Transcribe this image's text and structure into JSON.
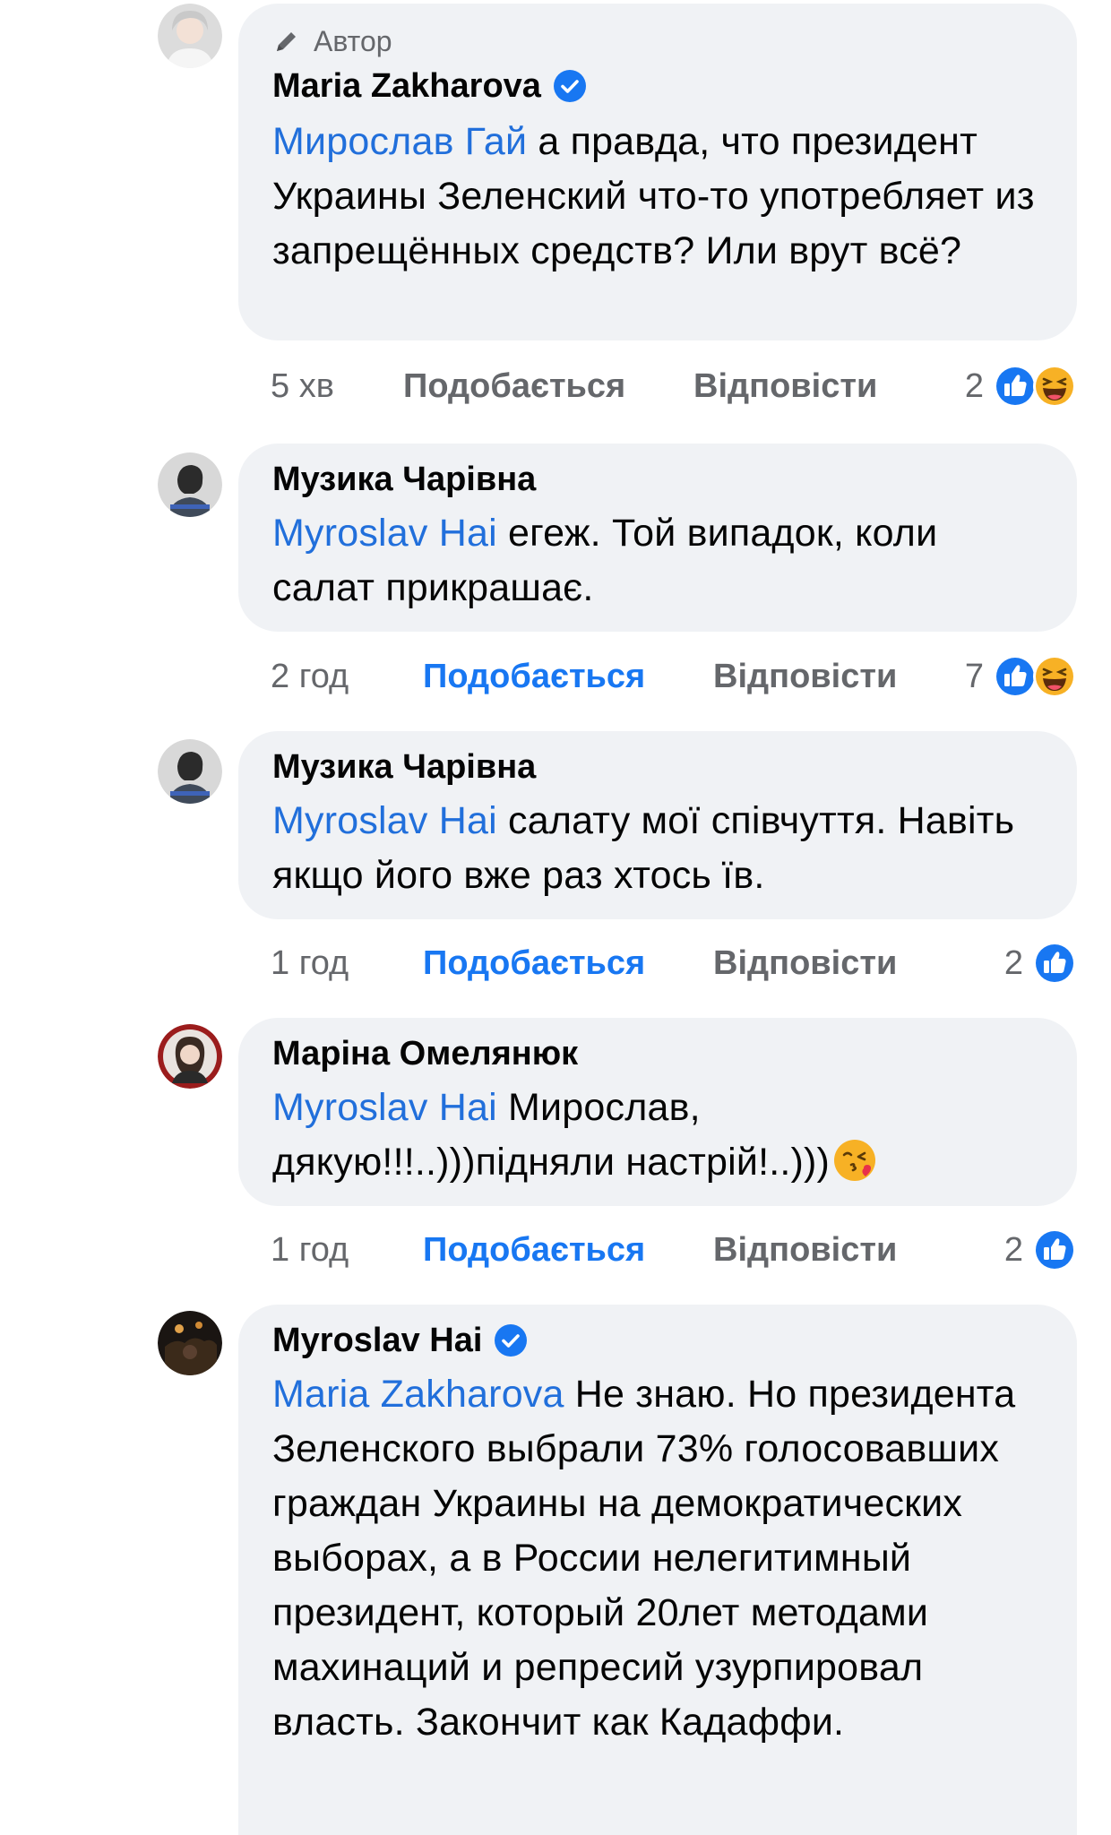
{
  "comments": [
    {
      "author_badge": "Автор",
      "name": "Maria Zakharova",
      "mention": "Мирослав Гай",
      "text": " а правда, что президент Украины Зеленский что-то употребляет из запрещённых средств? Или врут всё?",
      "time": "5 хв",
      "like_label": "Подобається",
      "reply_label": "Відповісти",
      "reaction_count": "2"
    },
    {
      "name": "Музика Чарівна",
      "mention": "Myroslav Hai",
      "text": " егеж. Той випадок, коли салат прикрашає.",
      "time": "2 год",
      "like_label": "Подобається",
      "reply_label": "Відповісти",
      "reaction_count": "7"
    },
    {
      "name": "Музика Чарівна",
      "mention": "Myroslav Hai",
      "text": " салату мої співчуття. Навіть якщо його вже раз хтось їв.",
      "time": "1 год",
      "like_label": "Подобається",
      "reply_label": "Відповісти",
      "reaction_count": "2"
    },
    {
      "name": "Маріна Омелянюк",
      "mention": "Myroslav Hai",
      "text": " Мирослав, дякую!!!..)))підняли настрій!..)))",
      "time": "1 год",
      "like_label": "Подобається",
      "reply_label": "Відповісти",
      "reaction_count": "2"
    },
    {
      "name": "Myroslav Hai",
      "mention": "Maria Zakharova",
      "text": " Не знаю. Но президента Зеленского выбрали 73% голосовавших граждан Украины на демократических выборах, а в России нелегитимный президент, который 20лет методами махинаций и репресий узурпировал власть. Закончит как Кадаффи."
    }
  ],
  "colors": {
    "bubble": "#f0f2f5",
    "mention": "#216fdb",
    "like_active": "#1877f2",
    "meta": "#65676b",
    "verified": "#1877f2"
  },
  "icons": {
    "author_badge": "pencil-icon",
    "verified": "verified-badge-icon",
    "like": "like-reaction-icon",
    "haha": "haha-reaction-icon",
    "kiss": "kissing-face-emoji"
  }
}
